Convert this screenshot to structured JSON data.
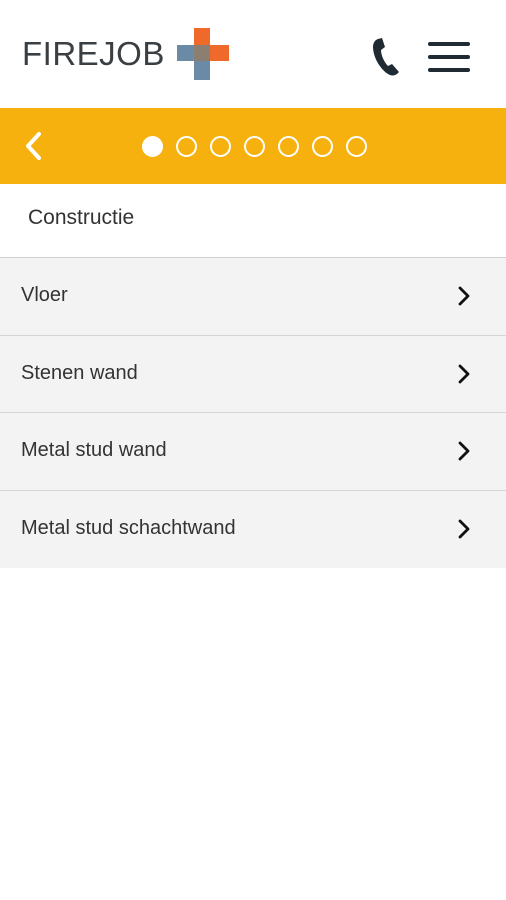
{
  "header": {
    "logo_text": "FIREJOB",
    "logo_icon": "firejob-plus-logo",
    "phone_icon": "phone-icon",
    "menu_icon": "hamburger-menu-icon"
  },
  "stepbar": {
    "back_icon": "chevron-left-icon",
    "total_steps": 7,
    "active_step": 1,
    "color": "#f7b10f"
  },
  "section": {
    "title": "Constructie"
  },
  "list": {
    "items": [
      {
        "label": "Vloer"
      },
      {
        "label": "Stenen wand"
      },
      {
        "label": "Metal stud wand"
      },
      {
        "label": "Metal stud schachtwand"
      }
    ],
    "chevron_icon": "chevron-right-icon"
  }
}
